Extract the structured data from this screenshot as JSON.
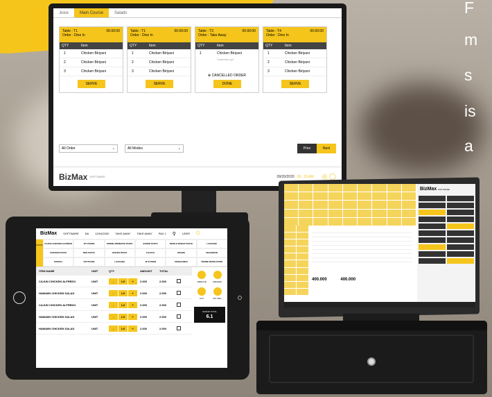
{
  "side_text": [
    "F",
    "m",
    "s",
    "is",
    "a"
  ],
  "monitor": {
    "tabs": [
      "Juice",
      "Main Course",
      "Salads"
    ],
    "active_tab": "Main Course",
    "cards": [
      {
        "table": "Table : T1",
        "time": "00:00:00",
        "order": "Order : Dine In",
        "cols": [
          "QTY",
          "Item"
        ],
        "rows": [
          [
            "1",
            "Chicken Biriyani"
          ],
          [
            "2",
            "Chicken Biriyani"
          ],
          [
            "3",
            "Chicken Biriyani"
          ]
        ],
        "button": "SERVE"
      },
      {
        "table": "Table : T1",
        "time": "00:00:00",
        "order": "Order : Dine In",
        "cols": [
          "QTY",
          "Item"
        ],
        "rows": [
          [
            "1",
            "Chicken Biriyani"
          ],
          [
            "2",
            "Chicken Biriyani"
          ],
          [
            "3",
            "Chicken Biriyani"
          ]
        ],
        "button": "SERVE"
      },
      {
        "table": "Table : T3",
        "time": "00:00:00",
        "order": "Order : Take Away",
        "cols": [
          "QTY",
          "Item"
        ],
        "rows": [
          [
            "1",
            "Chicken Biriyani"
          ]
        ],
        "note": "Customer ppl",
        "cancelled": "CANCELLED ORDER",
        "button": "DONE"
      },
      {
        "table": "Table : T4",
        "time": "00:00:00",
        "order": "Order : Dine In",
        "cols": [
          "QTY",
          "Item"
        ],
        "rows": [
          [
            "1",
            "Chicken Biriyani"
          ],
          [
            "2",
            "Chicken Biriyani"
          ],
          [
            "3",
            "Chicken Biriyani"
          ]
        ],
        "button": "SERVE"
      }
    ],
    "filter_order": "All Order",
    "filter_modes": "All Modes",
    "prev": "Prev",
    "next": "Next",
    "brand": "BizMax",
    "brand_sub": "SOFTWARE",
    "date": "09/20/2020",
    "time": "09 : 15 AM"
  },
  "tablet": {
    "brand": "BizMax",
    "brand_sub": "SOFTWARE",
    "header": [
      "NA",
      "12/04/2020",
      "TAKE AWAY",
      "TAKE AWAY",
      "PAX 1",
      "USER"
    ],
    "category": "PASTA",
    "grid": [
      "CAJUN CHICKEN ALFREDO",
      "JP FUSION",
      "PENNE ARRIBIATA PASTA",
      "BAKED PASTA",
      "WHOLE WHEAT PASTA",
      "LASAGNA",
      "CHICKEN PASTA",
      "RED PASTA",
      "BAKED PASTA",
      "FALFIYA",
      "SPAGIE",
      "MACHEESE",
      "RAVIOLI",
      "FETTUCINI",
      "LASAGNA",
      "JP FUSION",
      "MANAGRESI",
      "PENNE NEPOLITANO"
    ],
    "columns": [
      "ITEM NAME",
      "UNIT",
      "QTY",
      "AMOUNT",
      "TOTAL"
    ],
    "rows": [
      {
        "name": "CAJUN CHICKEN ALFREDO",
        "unit": "UNIT",
        "qty": "1.0",
        "amount": "2.000",
        "total": "2.000"
      },
      {
        "name": "HAWAIIN CHICKEN SALAD",
        "unit": "UNIT",
        "qty": "1.0",
        "amount": "2.000",
        "total": "2.000"
      },
      {
        "name": "CAJUN CHICKEN ALFREDO",
        "unit": "UNIT",
        "qty": "1.0",
        "amount": "2.000",
        "total": "2.000"
      },
      {
        "name": "HAWAIIN CHICKEN SALAD",
        "unit": "UNIT",
        "qty": "1.0",
        "amount": "2.000",
        "total": "2.000"
      },
      {
        "name": "HAWAIIN CHICKEN SALAD",
        "unit": "UNIT",
        "qty": "1.0",
        "amount": "2.000",
        "total": "2.000"
      }
    ],
    "actions": [
      "REMOVE",
      "REMARK",
      "KOT",
      "PAY BILL"
    ],
    "grand_label": "GRAND TOTAL",
    "grand_value": "6.1"
  },
  "pos": {
    "brand": "BizMax",
    "brand_sub": "SOFTWARE",
    "total_a": "400.000",
    "total_b": "400.000"
  }
}
